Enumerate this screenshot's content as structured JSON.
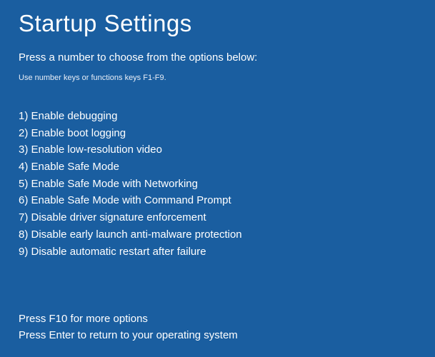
{
  "title": "Startup Settings",
  "subtitle": "Press a number to choose from the options below:",
  "hint": "Use number keys or functions keys F1-F9.",
  "options": [
    "1) Enable debugging",
    "2) Enable boot logging",
    "3) Enable low-resolution video",
    "4) Enable Safe Mode",
    "5) Enable Safe Mode with Networking",
    "6) Enable Safe Mode with Command Prompt",
    "7) Disable driver signature enforcement",
    "8) Disable early launch anti-malware protection",
    "9) Disable automatic restart after failure"
  ],
  "footer": {
    "more_options": "Press F10 for more options",
    "return_os": "Press Enter to return to your operating system"
  }
}
